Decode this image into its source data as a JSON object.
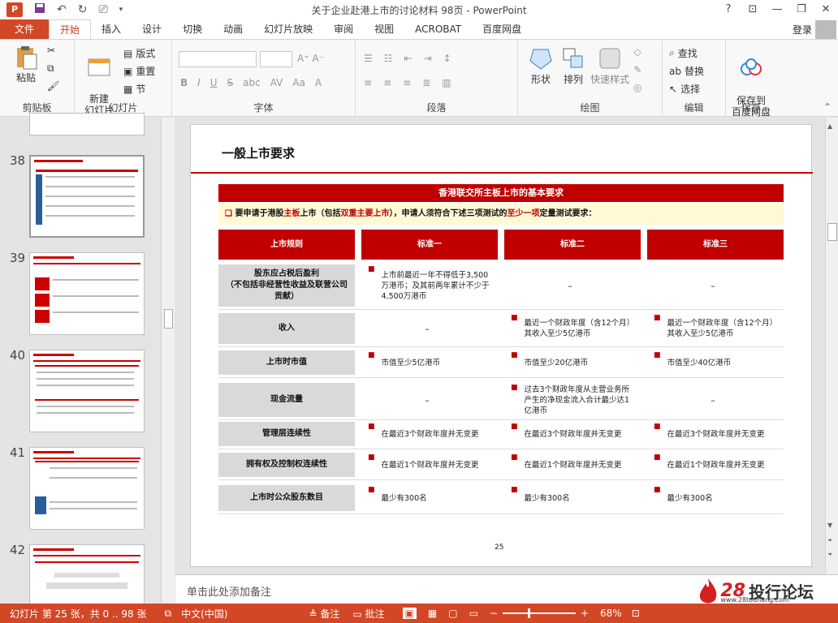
{
  "window": {
    "title": "关于企业赴港上市的讨论材料 98页 - PowerPoint",
    "help": "?",
    "min": "—",
    "restore": "❐",
    "close": "✕",
    "app_icon": "P"
  },
  "tabs": {
    "file": "文件",
    "items": [
      "开始",
      "插入",
      "设计",
      "切换",
      "动画",
      "幻灯片放映",
      "审阅",
      "视图",
      "ACROBAT",
      "百度网盘"
    ],
    "login": "登录"
  },
  "ribbon": {
    "paste": "粘贴",
    "clipboard": "剪贴板",
    "new_slide": "新建\n幻灯片",
    "layout": "版式",
    "reset": "重置",
    "section": "节",
    "slides": "幻灯片",
    "font": "字体",
    "paragraph": "段落",
    "shapes": "形状",
    "arrange": "排列",
    "quick_styles": "快速样式",
    "drawing": "绘图",
    "find": "查找",
    "replace": "替换",
    "select": "选择",
    "editing": "编辑",
    "save_baidu": "保存到\n百度网盘",
    "save": "保存"
  },
  "thumbnails": [
    "38",
    "39",
    "40",
    "41",
    "42"
  ],
  "slide": {
    "title": "一般上市要求",
    "banner": "香港联交所主板上市的基本要求",
    "sub": {
      "p1": "要申请于港股",
      "hl1": "主板",
      "p2": "上市（包括",
      "hl2": "双重主要上市",
      "p3": "），申请人须符合下述三项测试的",
      "hl3": "至少一项",
      "p4": "定量测试要求："
    },
    "headers": [
      "上市规则",
      "标准一",
      "标准二",
      "标准三"
    ],
    "rows": [
      {
        "label": "股东应占税后盈利\n（不包括非经营性收益及联营公司贡献）",
        "c1": "上市前最近一年不得低于3,500万港币；及其前两年累计不少于4,500万港币",
        "c2": "–",
        "c3": "–"
      },
      {
        "label": "收入",
        "c1": "–",
        "c2": "最近一个财政年度（含12个月）其收入至少5亿港币",
        "c3": "最近一个财政年度（含12个月）其收入至少5亿港币"
      },
      {
        "label": "上市时市值",
        "c1": "市值至少5亿港币",
        "c2": "市值至少20亿港币",
        "c3": "市值至少40亿港币"
      },
      {
        "label": "现金流量",
        "c1": "–",
        "c2": "过去3个财政年度从主营业务所产生的净现金流入合计最少达1亿港币",
        "c3": "–"
      },
      {
        "label": "管理层连续性",
        "c1": "在最近3个财政年度并无变更",
        "c2": "在最近3个财政年度并无变更",
        "c3": "在最近3个财政年度并无变更"
      },
      {
        "label": "拥有权及控制权连续性",
        "c1": "在最近1个财政年度并无变更",
        "c2": "在最近1个财政年度并无变更",
        "c3": "在最近1个财政年度并无变更"
      },
      {
        "label": "上市时公众股东数目",
        "c1": "最少有300名",
        "c2": "最少有300名",
        "c3": "最少有300名"
      }
    ],
    "page": "25"
  },
  "notes": {
    "placeholder": "单击此处添加备注",
    "logo_num": "28",
    "logo_text": "投行论坛",
    "logo_url": "www.28touhang.com"
  },
  "status": {
    "slide": "幻灯片 第 25 张，共 0 .. 98 张",
    "lang": "中文(中国)",
    "notes": "备注",
    "comments": "批注",
    "zoom": "68%",
    "zoom_level": 0.68
  },
  "colors": {
    "accent": "#d24726",
    "slide_red": "#c00000"
  }
}
